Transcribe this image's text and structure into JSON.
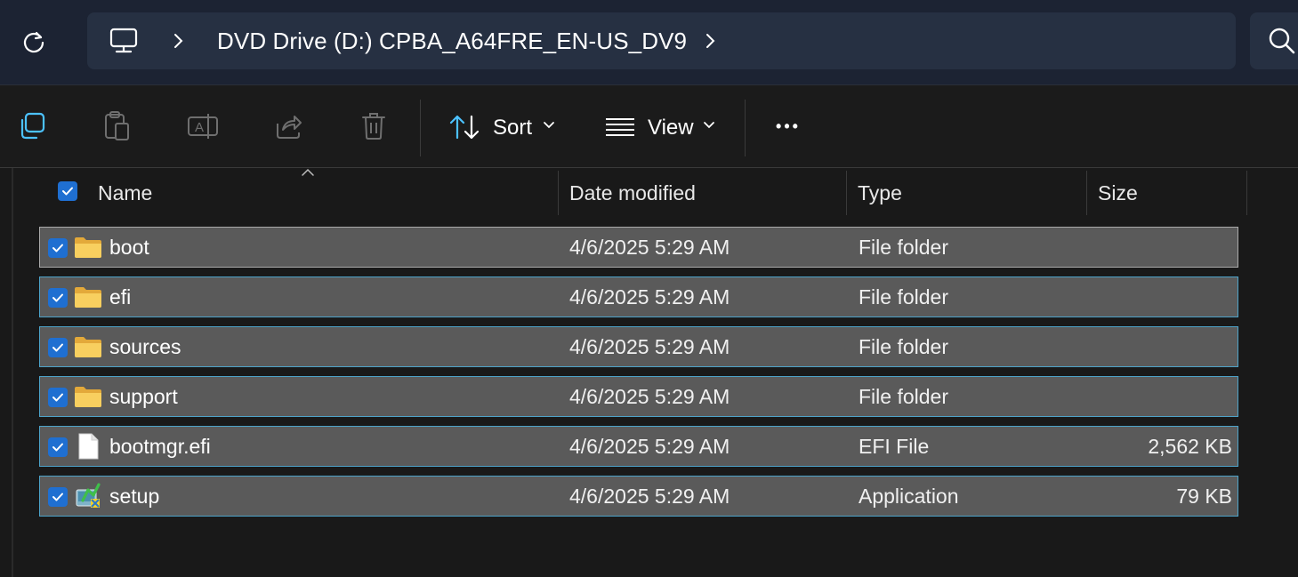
{
  "address_bar": {
    "breadcrumb_icon": "computer-icon",
    "path_label": "DVD Drive (D:) CPBA_A64FRE_EN-US_DV9",
    "refresh_icon": "refresh-icon",
    "search_icon": "search-icon"
  },
  "command_bar": {
    "copy_icon": "copy-icon",
    "paste_icon": "paste-icon",
    "rename_icon": "rename-icon",
    "share_icon": "share-icon",
    "delete_icon": "delete-icon",
    "sort_label": "Sort",
    "view_label": "View",
    "more_label": "•••"
  },
  "columns": {
    "name": "Name",
    "date": "Date modified",
    "type": "Type",
    "size": "Size"
  },
  "rows": [
    {
      "name": "boot",
      "date": "4/6/2025 5:29 AM",
      "type": "File folder",
      "size": "",
      "icon": "folder-icon"
    },
    {
      "name": "efi",
      "date": "4/6/2025 5:29 AM",
      "type": "File folder",
      "size": "",
      "icon": "folder-icon"
    },
    {
      "name": "sources",
      "date": "4/6/2025 5:29 AM",
      "type": "File folder",
      "size": "",
      "icon": "folder-icon"
    },
    {
      "name": "support",
      "date": "4/6/2025 5:29 AM",
      "type": "File folder",
      "size": "",
      "icon": "folder-icon"
    },
    {
      "name": "bootmgr.efi",
      "date": "4/6/2025 5:29 AM",
      "type": "EFI File",
      "size": "2,562 KB",
      "icon": "file-icon"
    },
    {
      "name": "setup",
      "date": "4/6/2025 5:29 AM",
      "type": "Application",
      "size": "79 KB",
      "icon": "setup-app-icon"
    }
  ],
  "colors": {
    "accent": "#1f6fd1",
    "selection_border": "#4da3c9",
    "selection_bg": "#5a5a5a",
    "folder": "#f6c650"
  }
}
